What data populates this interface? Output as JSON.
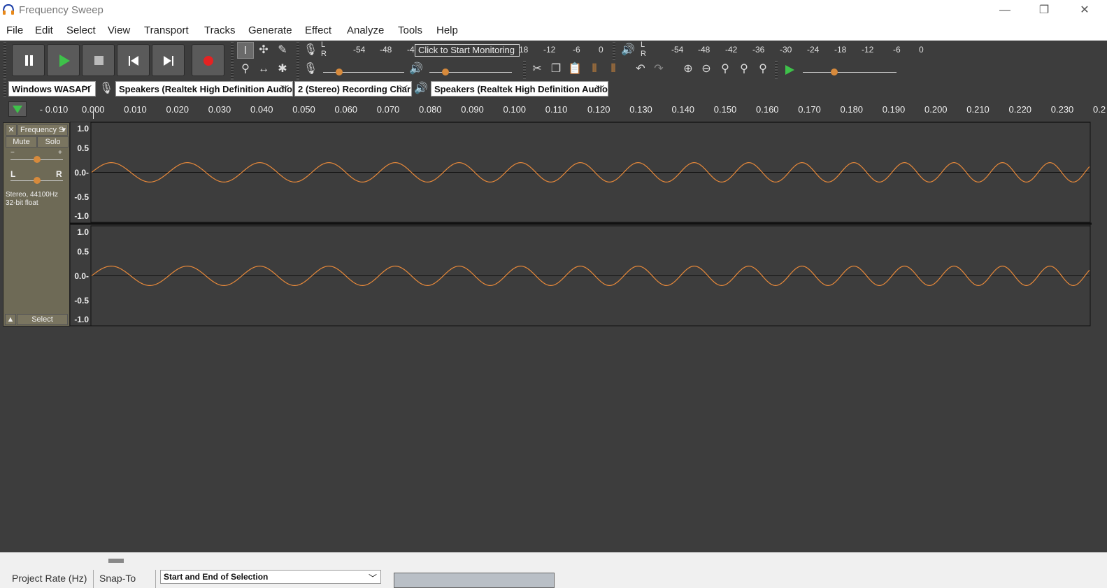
{
  "window": {
    "title": "Frequency Sweep",
    "minimize": "—",
    "restore": "❐",
    "close": "✕"
  },
  "menu": [
    "File",
    "Edit",
    "Select",
    "View",
    "Transport",
    "Tracks",
    "Generate",
    "Effect",
    "Analyze",
    "Tools",
    "Help"
  ],
  "meters": {
    "rec_ticks": [
      "-54",
      "-48",
      "-4",
      "18",
      "-12",
      "-6",
      "0"
    ],
    "play_ticks": [
      "-54",
      "-48",
      "-42",
      "-36",
      "-30",
      "-24",
      "-18",
      "-12",
      "-6",
      "0"
    ],
    "monitor_label": "Click to Start Monitoring",
    "lr": [
      "L",
      "R"
    ]
  },
  "device": {
    "host": "Windows WASAPI",
    "recording_device": "Speakers (Realtek High Definition Audio)",
    "channels": "2 (Stereo) Recording Char",
    "playback_device": "Speakers (Realtek High Definition Audio)"
  },
  "ruler": [
    "- 0.010",
    "0.000",
    "0.010",
    "0.020",
    "0.030",
    "0.040",
    "0.050",
    "0.060",
    "0.070",
    "0.080",
    "0.090",
    "0.100",
    "0.110",
    "0.120",
    "0.130",
    "0.140",
    "0.150",
    "0.160",
    "0.170",
    "0.180",
    "0.190",
    "0.200",
    "0.210",
    "0.220",
    "0.230",
    "0.2"
  ],
  "track": {
    "name": "Frequency S",
    "close": "✕",
    "mute": "Mute",
    "solo": "Solo",
    "gain_minus": "−",
    "gain_plus": "+",
    "pan_left": "L",
    "pan_right": "R",
    "info_line1": "Stereo, 44100Hz",
    "info_line2": "32-bit float",
    "select": "Select",
    "scale": [
      "1.0",
      "0.5",
      "0.0-",
      "-0.5",
      "-1.0"
    ]
  },
  "colors": {
    "waveform": "#e8893a",
    "track_bg": "#3d3d3d",
    "panel": "#6e6a56"
  },
  "status": {
    "project_rate": "Project Rate (Hz)",
    "snap_to": "Snap-To",
    "selection_mode": "Start and End of Selection"
  }
}
